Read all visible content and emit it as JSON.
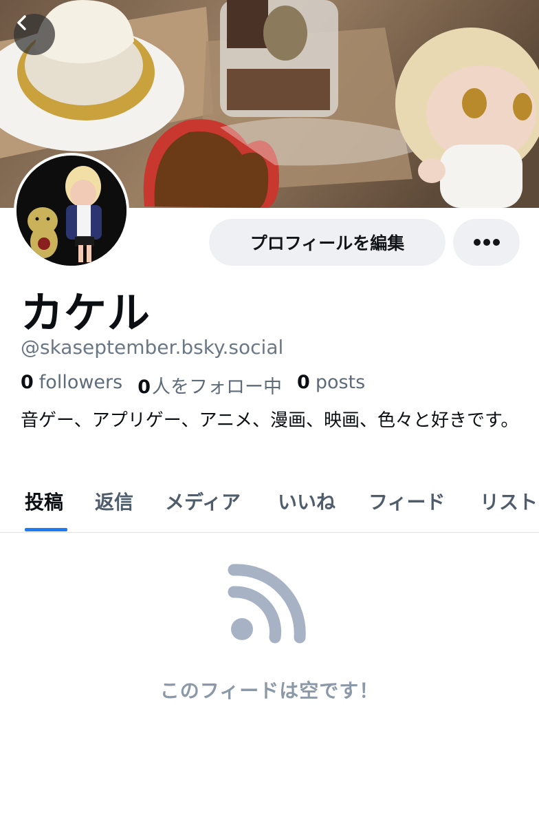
{
  "header": {
    "banner_icon": "banner-photo",
    "back_icon": "chevron-left-icon"
  },
  "profile": {
    "display_name": "カケル",
    "handle": "@skaseptember.bsky.social",
    "followers_count": "0",
    "followers_label": "followers",
    "following_count": "0",
    "following_label": "人をフォロー中",
    "posts_count": "0",
    "posts_label": "posts",
    "bio": "音ゲー、アプリゲー、アニメ、漫画、映画、色々と好きです。"
  },
  "actions": {
    "edit_profile_label": "プロフィールを編集",
    "more_icon": "more-dots-icon"
  },
  "tabs": [
    {
      "label": "投稿",
      "active": true
    },
    {
      "label": "返信",
      "active": false
    },
    {
      "label": "メディア",
      "active": false
    },
    {
      "label": "いいね",
      "active": false
    },
    {
      "label": "フィード",
      "active": false
    },
    {
      "label": "リスト",
      "active": false
    }
  ],
  "empty_state": {
    "icon": "rss-feed-icon",
    "message": "このフィードは空です！"
  },
  "colors": {
    "accent": "#1d7cf2",
    "button_bg": "#eef0f3",
    "muted_text": "#6a7785",
    "empty_text": "#8b98a8"
  }
}
